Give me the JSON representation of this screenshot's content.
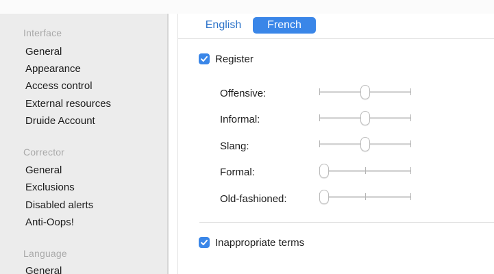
{
  "sidebar": {
    "sections": [
      {
        "header": "Interface",
        "items": [
          "General",
          "Appearance",
          "Access control",
          "External resources",
          "Druide Account"
        ]
      },
      {
        "header": "Corrector",
        "items": [
          "General",
          "Exclusions",
          "Disabled alerts",
          "Anti-Oops!"
        ]
      },
      {
        "header": "Language",
        "items": [
          "General"
        ]
      }
    ]
  },
  "language_tabs": {
    "english": "English",
    "french": "French",
    "selected": "French"
  },
  "register": {
    "label": "Register",
    "checked": true,
    "sliders": [
      {
        "label": "Offensive:",
        "level_fraction": 0.5
      },
      {
        "label": "Informal:",
        "level_fraction": 0.5
      },
      {
        "label": "Slang:",
        "level_fraction": 0.5
      },
      {
        "label": "Formal:",
        "level_fraction": 0.0
      },
      {
        "label": "Old-fashioned:",
        "level_fraction": 0.0
      }
    ]
  },
  "inappropriate_terms": {
    "label": "Inappropriate terms",
    "checked": true
  },
  "colors": {
    "accent": "#3a86e8",
    "link": "#2b73c9",
    "sidebar_bg": "#ececec"
  }
}
